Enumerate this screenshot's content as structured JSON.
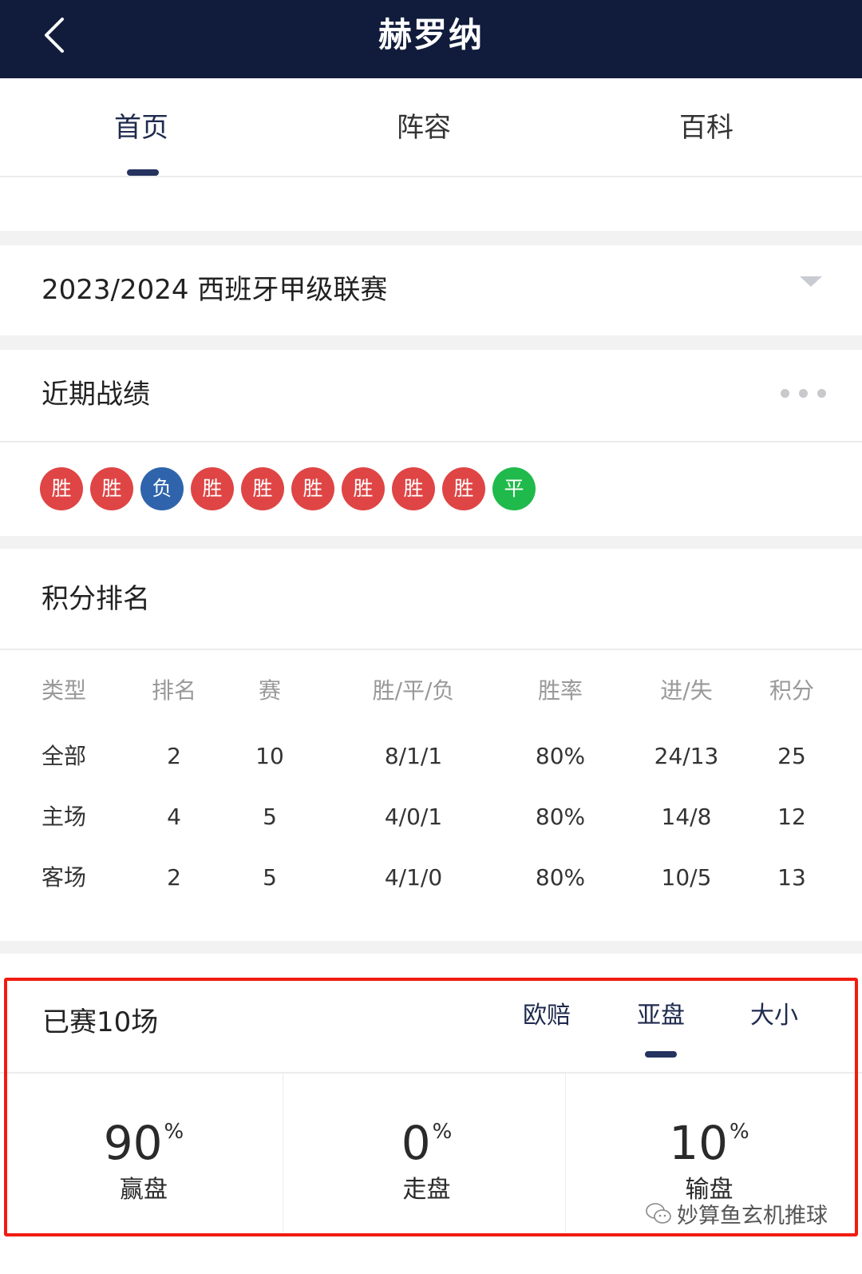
{
  "header": {
    "title": "赫罗纳",
    "back_icon": "chevron-left-icon"
  },
  "tabs": [
    {
      "label": "首页",
      "active": true
    },
    {
      "label": "阵容",
      "active": false
    },
    {
      "label": "百科",
      "active": false
    }
  ],
  "season": {
    "selected": "2023/2024 西班牙甲级联赛",
    "icon": "dropdown-triangle-icon"
  },
  "recent_form": {
    "title": "近期战绩",
    "more_icon": "more-dots-icon",
    "results": [
      {
        "label": "胜",
        "color": "#df4545"
      },
      {
        "label": "胜",
        "color": "#df4545"
      },
      {
        "label": "负",
        "color": "#2f64ac"
      },
      {
        "label": "胜",
        "color": "#df4545"
      },
      {
        "label": "胜",
        "color": "#df4545"
      },
      {
        "label": "胜",
        "color": "#df4545"
      },
      {
        "label": "胜",
        "color": "#df4545"
      },
      {
        "label": "胜",
        "color": "#df4545"
      },
      {
        "label": "胜",
        "color": "#df4545"
      },
      {
        "label": "平",
        "color": "#1fba4b"
      }
    ]
  },
  "standings": {
    "title": "积分排名",
    "columns": [
      "类型",
      "排名",
      "赛",
      "胜/平/负",
      "胜率",
      "进/失",
      "积分"
    ],
    "rows": [
      [
        "全部",
        "2",
        "10",
        "8/1/1",
        "80%",
        "24/13",
        "25"
      ],
      [
        "主场",
        "4",
        "5",
        "4/0/1",
        "80%",
        "14/8",
        "12"
      ],
      [
        "客场",
        "2",
        "5",
        "4/1/0",
        "80%",
        "10/5",
        "13"
      ]
    ]
  },
  "record": {
    "title": "已赛10场",
    "tabs": [
      {
        "label": "欧赔",
        "active": false
      },
      {
        "label": "亚盘",
        "active": true
      },
      {
        "label": "大小",
        "active": false
      }
    ],
    "stats": [
      {
        "value": "90",
        "unit": "%",
        "label": "赢盘"
      },
      {
        "value": "0",
        "unit": "%",
        "label": "走盘"
      },
      {
        "value": "10",
        "unit": "%",
        "label": "输盘"
      }
    ],
    "highlight_color": "#f01c10"
  },
  "watermark": {
    "text": "妙算鱼玄机推球",
    "icon": "wechat-icon"
  },
  "colors": {
    "header_bg": "#111c3c",
    "accent": "#25335e"
  }
}
